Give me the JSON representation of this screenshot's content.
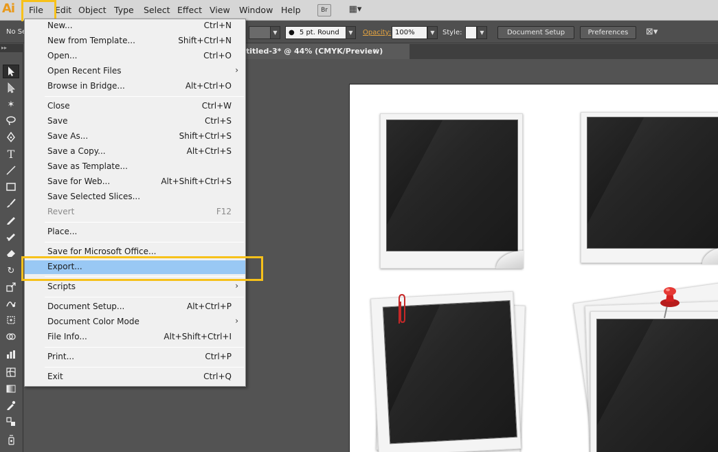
{
  "app": {
    "logo": "Ai"
  },
  "menubar": {
    "items": [
      "File",
      "Edit",
      "Object",
      "Type",
      "Select",
      "Effect",
      "View",
      "Window",
      "Help"
    ],
    "bridge_btn": "Br",
    "arrange_btn": "▦▾"
  },
  "controlbar": {
    "selection_label": "No Se",
    "stroke_profile": "5 pt. Round",
    "opacity_label": "Opacity:",
    "opacity_value": "100%",
    "style_label": "Style:",
    "document_setup": "Document Setup",
    "preferences": "Preferences"
  },
  "document_tab": {
    "title": "titled-3* @ 44% (CMYK/Preview)",
    "close": "×"
  },
  "file_menu": {
    "items": [
      {
        "label": "New...",
        "shortcut": "Ctrl+N"
      },
      {
        "label": "New from Template...",
        "shortcut": "Shift+Ctrl+N"
      },
      {
        "label": "Open...",
        "shortcut": "Ctrl+O"
      },
      {
        "label": "Open Recent Files",
        "shortcut": "",
        "submenu": "›"
      },
      {
        "label": "Browse in Bridge...",
        "shortcut": "Alt+Ctrl+O"
      },
      {
        "label": "Close",
        "shortcut": "Ctrl+W"
      },
      {
        "label": "Save",
        "shortcut": "Ctrl+S"
      },
      {
        "label": "Save As...",
        "shortcut": "Shift+Ctrl+S"
      },
      {
        "label": "Save a Copy...",
        "shortcut": "Alt+Ctrl+S"
      },
      {
        "label": "Save as Template...",
        "shortcut": ""
      },
      {
        "label": "Save for Web...",
        "shortcut": "Alt+Shift+Ctrl+S"
      },
      {
        "label": "Save Selected Slices...",
        "shortcut": ""
      },
      {
        "label": "Revert",
        "shortcut": "F12"
      },
      {
        "label": "Place...",
        "shortcut": ""
      },
      {
        "label": "Save for Microsoft Office...",
        "shortcut": ""
      },
      {
        "label": "Export...",
        "shortcut": ""
      },
      {
        "label": "Scripts",
        "shortcut": "",
        "submenu": "›"
      },
      {
        "label": "Document Setup...",
        "shortcut": "Alt+Ctrl+P"
      },
      {
        "label": "Document Color Mode",
        "shortcut": "",
        "submenu": "›"
      },
      {
        "label": "File Info...",
        "shortcut": "Alt+Shift+Ctrl+I"
      },
      {
        "label": "Print...",
        "shortcut": "Ctrl+P"
      },
      {
        "label": "Exit",
        "shortcut": "Ctrl+Q"
      }
    ],
    "selected_item": "Export...",
    "disabled_item": "Revert"
  },
  "toolbar": {
    "tools": [
      "selection-tool",
      "direct-selection-tool",
      "magic-wand-tool",
      "lasso-tool",
      "pen-tool",
      "type-tool",
      "line-tool",
      "rectangle-tool",
      "paintbrush-tool",
      "pencil-tool",
      "blob-brush-tool",
      "eraser-tool",
      "rotate-tool",
      "scale-tool",
      "warp-tool",
      "free-transform-tool",
      "shape-builder-tool",
      "graph-tool",
      "mesh-tool",
      "gradient-tool",
      "eyedropper-tool",
      "blend-tool",
      "symbol-sprayer-tool"
    ]
  },
  "colors": {
    "highlight": "#f7c11a",
    "menu_selected": "#99c8f4",
    "logo": "#e8991c",
    "opacity_label": "#e8a640",
    "pushpin": "#d42020",
    "paperclip": "#c62828"
  }
}
